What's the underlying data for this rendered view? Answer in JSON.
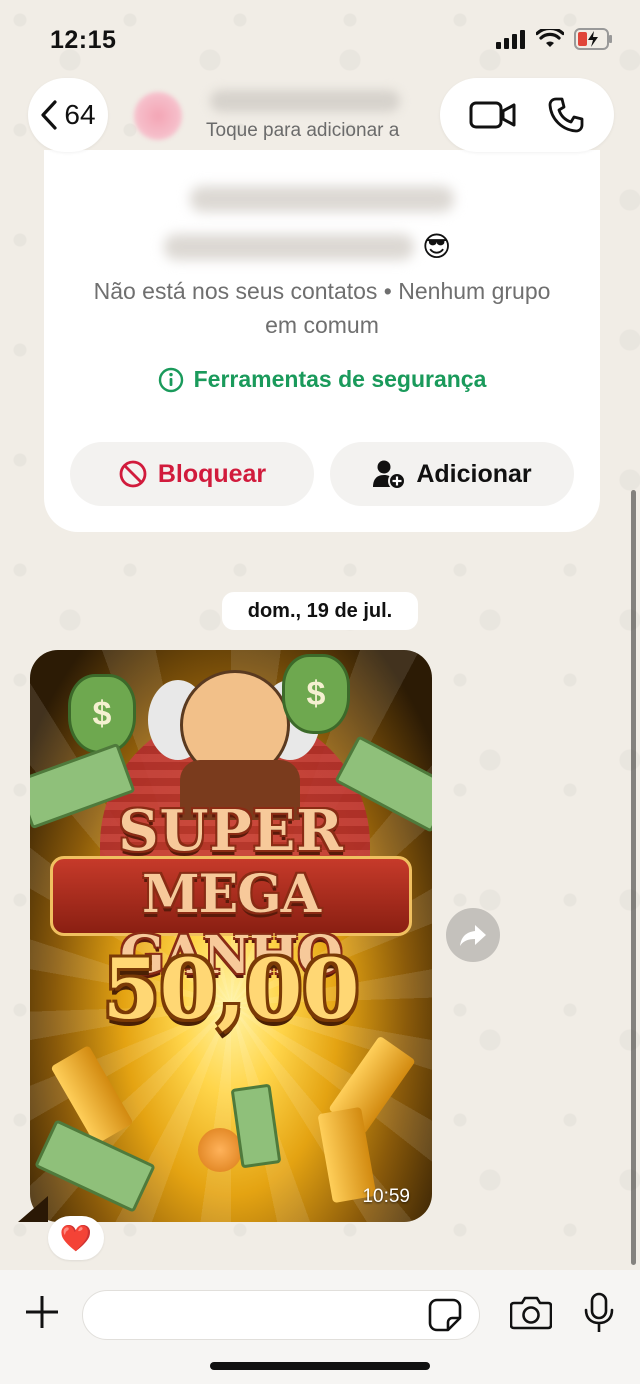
{
  "status_bar": {
    "time": "12:15"
  },
  "header": {
    "back_count": "64",
    "subtitle": "Toque para adicionar a"
  },
  "contact_card": {
    "emoji": "😎",
    "not_contact_text": "Não está nos seus contatos • Nenhum grupo em comum",
    "security_tools": "Ferramentas de segurança",
    "block_label": "Bloquear",
    "add_label": "Adicionar"
  },
  "chat": {
    "date_label": "dom., 19 de jul.",
    "messages": [
      {
        "type": "image",
        "image_text": {
          "line1": "SUPER",
          "line2": "MEGA GANHO",
          "amount": "50,00"
        },
        "time": "10:59",
        "reaction": "❤️"
      }
    ]
  },
  "colors": {
    "accent_green": "#1a9a5b",
    "block_red": "#d11b3c",
    "background": "#efeae2"
  }
}
